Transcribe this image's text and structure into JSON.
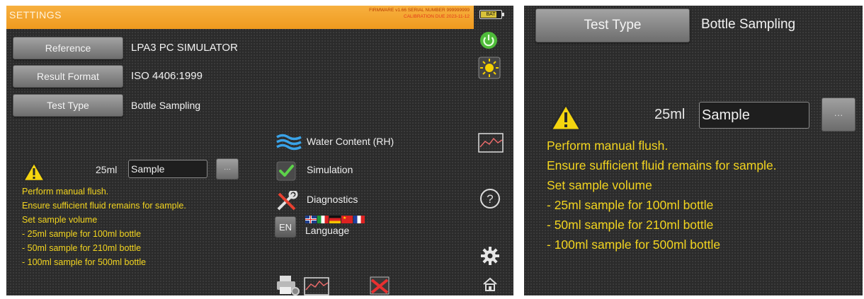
{
  "left": {
    "title": "SETTINGS",
    "firmware_line": "FIRMWARE v1.66 SERIAL NUMBER 999999999",
    "calibration_line": "CALIBRATION DUE 2023-11-12",
    "battery_label": "BAT",
    "battery_level": 0.8,
    "settings": [
      {
        "button": "Reference",
        "value": "LPA3 PC SIMULATOR"
      },
      {
        "button": "Result Format",
        "value": "ISO 4406:1999"
      },
      {
        "button": "Test Type",
        "value": "Bottle Sampling"
      }
    ],
    "volume": "25ml",
    "sample_value": "Sample",
    "more_label": "···",
    "messages": [
      "Perform manual flush.",
      "Ensure sufficient fluid remains for sample.",
      "Set sample volume",
      "- 25ml sample for 100ml bottle",
      "- 50ml sample for 210ml bottle",
      "- 100ml sample for 500ml bottle"
    ],
    "menu": {
      "water_content": "Water Content (RH)",
      "simulation": "Simulation",
      "diagnostics": "Diagnostics",
      "language": "Language",
      "language_code": "EN"
    },
    "icon_names": [
      "power-icon",
      "brightness-icon",
      "graph-icon",
      "help-icon",
      "gear-icon",
      "home-icon",
      "printer-icon",
      "clear-graph-icon"
    ]
  },
  "right": {
    "test_type_button": "Test Type",
    "test_type_value": "Bottle Sampling",
    "volume": "25ml",
    "sample_value": "Sample",
    "more_label": "···",
    "messages": [
      "Perform manual flush.",
      "Ensure sufficient fluid remains for sample.",
      "Set sample volume",
      "- 25ml sample for 100ml bottle",
      "- 50ml sample for 210ml bottle",
      "- 100ml sample for 500ml bottle"
    ]
  },
  "colors": {
    "title_bar": "#f0a330",
    "message_text": "#f2d41f",
    "warning": "#f5d50f",
    "background": "#2b2b2b"
  }
}
